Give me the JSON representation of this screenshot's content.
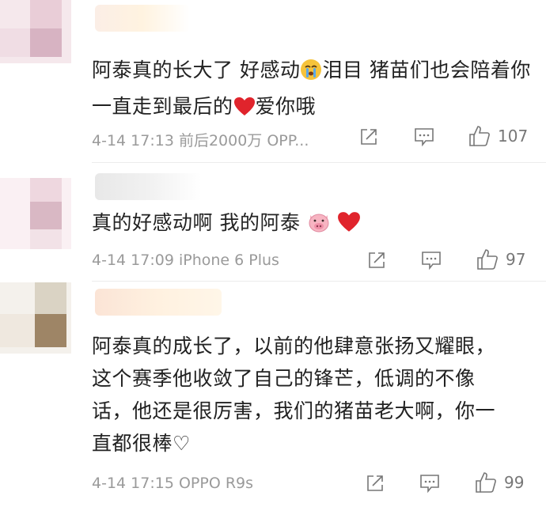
{
  "comments": [
    {
      "text_parts": [
        "阿泰真的长大了 好感动",
        "泪目  猪苗们也会陪着你一直走到最后的",
        "爱你哦"
      ],
      "meta": "4-14 17:13  前后2000万 OPP...",
      "likes": "107"
    },
    {
      "text_parts": [
        "真的好感动啊  我的阿泰",
        ""
      ],
      "meta": "4-14 17:09  iPhone 6 Plus",
      "likes": "97"
    },
    {
      "text": "阿泰真的成长了，以前的他肆意张扬又耀眼，这个赛季他收敛了自己的锋芒，低调的不像话，他还是很厉害，我们的猪苗老大啊，你一直都很棒♡",
      "meta": "4-14 17:15  OPPO R9s",
      "likes": "99"
    }
  ],
  "icons": {
    "share": "share-icon",
    "comment": "comment-icon",
    "like": "thumbs-up-icon",
    "crying": "crying-face-emoji",
    "heart": "red-heart-emoji",
    "pig": "pig-face-emoji"
  },
  "colors": {
    "meta": "#9a9a9a",
    "heart": "#e0242c",
    "pig": "#f7b4c2"
  }
}
